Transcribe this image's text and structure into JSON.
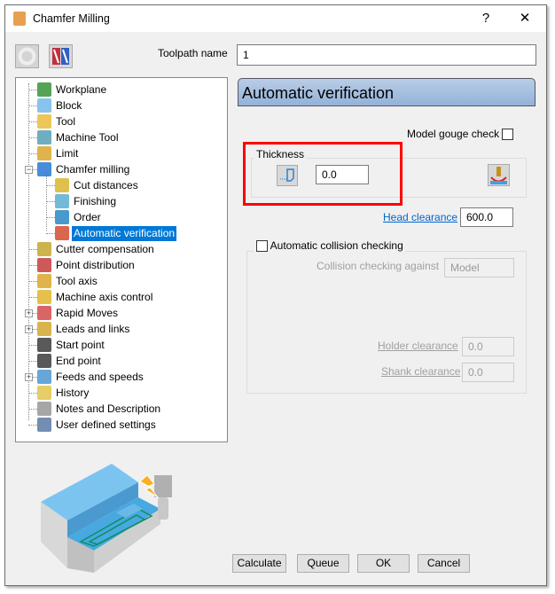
{
  "window": {
    "title": "Chamfer Milling",
    "help": "?",
    "close": "✕",
    "logo": "P"
  },
  "toolpath_name": {
    "label": "Toolpath name",
    "value": "1"
  },
  "tree": [
    {
      "label": "Workplane",
      "icon": "workplane-icon",
      "color": "#2a8c2a"
    },
    {
      "label": "Block",
      "icon": "block-icon",
      "color": "#6ab4e8"
    },
    {
      "label": "Tool",
      "icon": "tool-icon",
      "color": "#e8b830"
    },
    {
      "label": "Machine Tool",
      "icon": "machine-tool-icon",
      "color": "#4a9ab0"
    },
    {
      "label": "Limit",
      "icon": "limit-icon",
      "color": "#d8a020"
    },
    {
      "label": "Chamfer milling",
      "icon": "chamfer-milling-icon",
      "color": "#1a70d0"
    },
    {
      "label": "Cut distances",
      "icon": "cut-distances-icon",
      "color": "#d8b020"
    },
    {
      "label": "Finishing",
      "icon": "finishing-icon",
      "color": "#50a8d0"
    },
    {
      "label": "Order",
      "icon": "order-icon",
      "color": "#1a80c0"
    },
    {
      "label": "Automatic verification",
      "icon": "automatic-verification-icon",
      "color": "#d04020"
    },
    {
      "label": "Cutter compensation",
      "icon": "cutter-compensation-icon",
      "color": "#c0a020"
    },
    {
      "label": "Point distribution",
      "icon": "point-distribution-icon",
      "color": "#c03030"
    },
    {
      "label": "Tool axis",
      "icon": "tool-axis-icon",
      "color": "#d8a020"
    },
    {
      "label": "Machine axis control",
      "icon": "machine-axis-control-icon",
      "color": "#e0b020"
    },
    {
      "label": "Rapid Moves",
      "icon": "rapid-moves-icon",
      "color": "#d04040"
    },
    {
      "label": "Leads and links",
      "icon": "leads-and-links-icon",
      "color": "#d0a020"
    },
    {
      "label": "Start point",
      "icon": "start-point-icon",
      "color": "#303030"
    },
    {
      "label": "End point",
      "icon": "end-point-icon",
      "color": "#303030"
    },
    {
      "label": "Feeds and speeds",
      "icon": "feeds-and-speeds-icon",
      "color": "#4090d0"
    },
    {
      "label": "History",
      "icon": "history-icon",
      "color": "#e0c040"
    },
    {
      "label": "Notes and Description",
      "icon": "notes-icon",
      "color": "#909090"
    },
    {
      "label": "User defined settings",
      "icon": "user-settings-icon",
      "color": "#5070a0"
    }
  ],
  "panel": {
    "header": "Automatic verification",
    "model_gouge_check": {
      "label": "Model gouge check",
      "checked": false
    },
    "thickness": {
      "label": "Thickness",
      "value": "0.0"
    },
    "head_clearance": {
      "label": "Head clearance",
      "value": "600.0"
    },
    "collision": {
      "label": "Automatic collision checking",
      "checked": false,
      "against_label": "Collision checking against",
      "against_value": "Model",
      "holder_label": "Holder clearance",
      "holder_value": "0.0",
      "shank_label": "Shank clearance",
      "shank_value": "0.0"
    }
  },
  "buttons": {
    "calculate": "Calculate",
    "queue": "Queue",
    "ok": "OK",
    "cancel": "Cancel"
  }
}
